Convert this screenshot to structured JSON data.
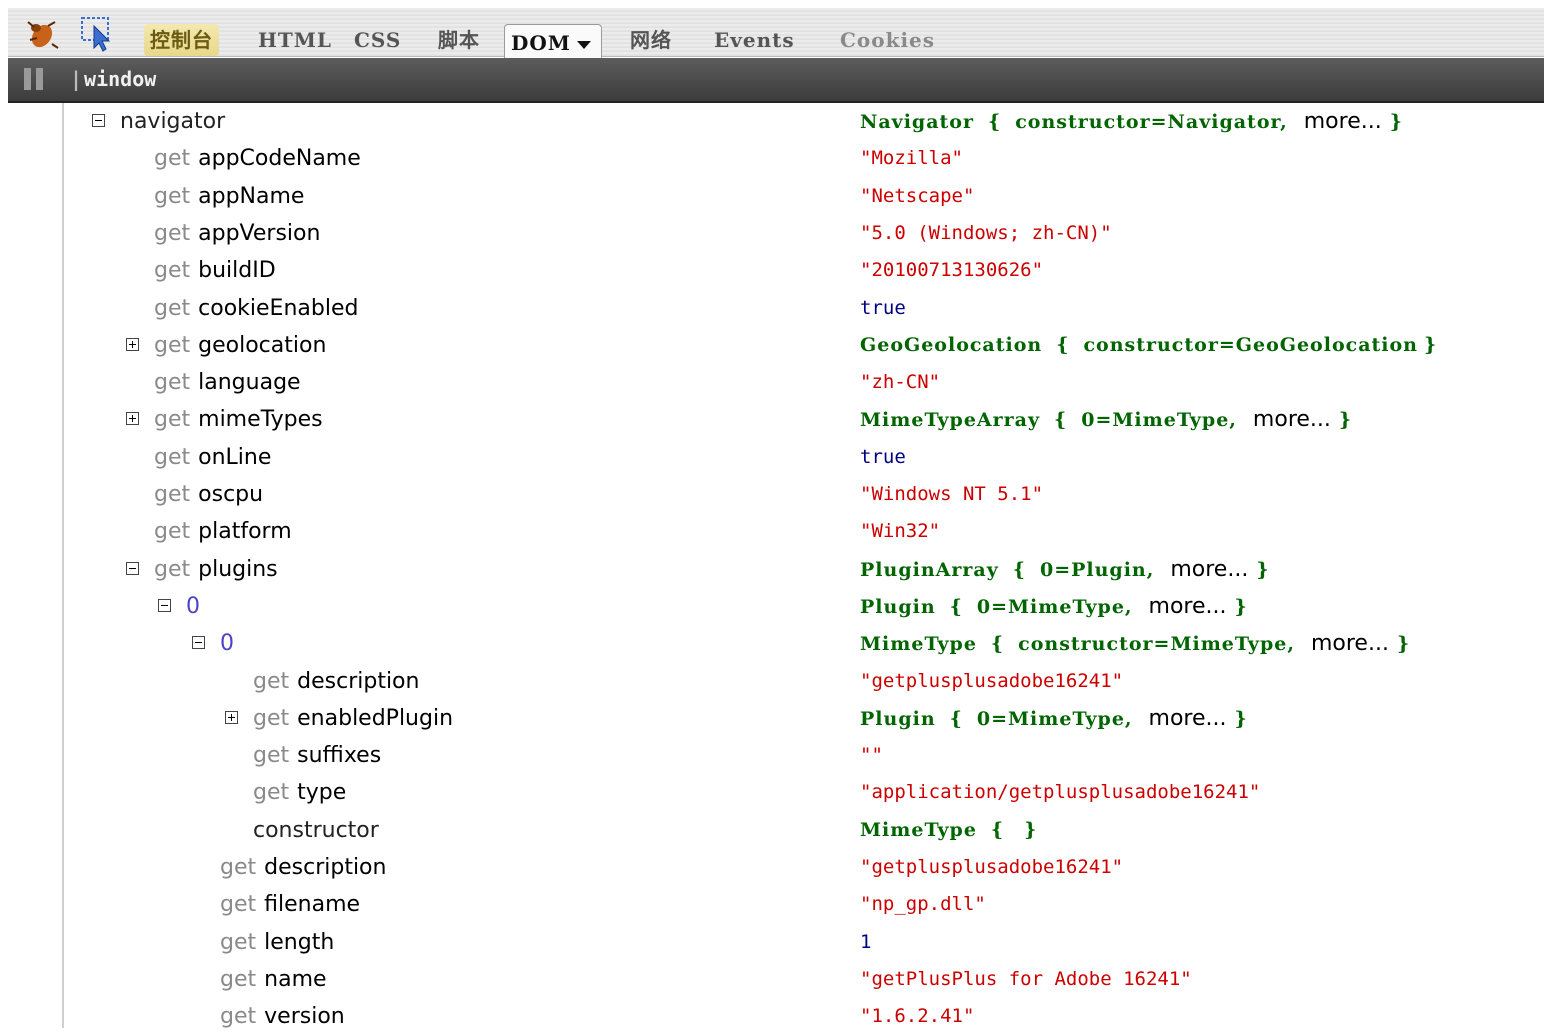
{
  "toolbar": {
    "tabs": [
      {
        "label": "控制台"
      },
      {
        "label": "HTML"
      },
      {
        "label": "CSS"
      },
      {
        "label": "脚本"
      },
      {
        "label": "DOM"
      },
      {
        "label": "网络"
      },
      {
        "label": "Events"
      },
      {
        "label": "Cookies"
      }
    ],
    "active_tab": "DOM"
  },
  "breadcrumb": {
    "separator": "|",
    "label": "window"
  },
  "tree": [
    {
      "prefix": "",
      "name": "navigator",
      "toggle": "minus",
      "value_type": "obj",
      "value": "Navigator",
      "value_inner": "constructor=Navigator,",
      "more": "more...",
      "name_style": "plain"
    },
    {
      "prefix": "get",
      "name": "appCodeName",
      "toggle": "",
      "value_type": "str",
      "value": "\"Mozilla\""
    },
    {
      "prefix": "get",
      "name": "appName",
      "toggle": "",
      "value_type": "str",
      "value": "\"Netscape\""
    },
    {
      "prefix": "get",
      "name": "appVersion",
      "toggle": "",
      "value_type": "str",
      "value": "\"5.0 (Windows; zh-CN)\""
    },
    {
      "prefix": "get",
      "name": "buildID",
      "toggle": "",
      "value_type": "str",
      "value": "\"20100713130626\""
    },
    {
      "prefix": "get",
      "name": "cookieEnabled",
      "toggle": "",
      "value_type": "bool",
      "value": "true"
    },
    {
      "prefix": "get",
      "name": "geolocation",
      "toggle": "plus",
      "value_type": "obj",
      "value": "GeoGeolocation",
      "value_inner": "constructor=GeoGeolocation",
      "more": ""
    },
    {
      "prefix": "get",
      "name": "language",
      "toggle": "",
      "value_type": "str",
      "value": "\"zh-CN\""
    },
    {
      "prefix": "get",
      "name": "mimeTypes",
      "toggle": "plus",
      "value_type": "obj",
      "value": "MimeTypeArray",
      "value_inner": "0=MimeType,",
      "more": "more..."
    },
    {
      "prefix": "get",
      "name": "onLine",
      "toggle": "",
      "value_type": "bool",
      "value": "true"
    },
    {
      "prefix": "get",
      "name": "oscpu",
      "toggle": "",
      "value_type": "str",
      "value": "\"Windows NT 5.1\""
    },
    {
      "prefix": "get",
      "name": "platform",
      "toggle": "",
      "value_type": "str",
      "value": "\"Win32\""
    },
    {
      "prefix": "get",
      "name": "plugins",
      "toggle": "minus",
      "value_type": "obj",
      "value": "PluginArray",
      "value_inner": "0=Plugin,",
      "more": "more..."
    },
    {
      "prefix": "",
      "name": "0",
      "toggle": "minus",
      "value_type": "obj",
      "value": "Plugin",
      "value_inner": "0=MimeType,",
      "more": "more...",
      "name_style": "idx"
    },
    {
      "prefix": "",
      "name": "0",
      "toggle": "minus",
      "value_type": "obj",
      "value": "MimeType",
      "value_inner": "constructor=MimeType,",
      "more": "more...",
      "name_style": "idx"
    },
    {
      "prefix": "get",
      "name": "description",
      "toggle": "",
      "value_type": "str",
      "value": "\"getplusplusadobe16241\""
    },
    {
      "prefix": "get",
      "name": "enabledPlugin",
      "toggle": "plus",
      "value_type": "obj",
      "value": "Plugin",
      "value_inner": "0=MimeType,",
      "more": "more..."
    },
    {
      "prefix": "get",
      "name": "suffixes",
      "toggle": "",
      "value_type": "str",
      "value": "\"\""
    },
    {
      "prefix": "get",
      "name": "type",
      "toggle": "",
      "value_type": "str",
      "value": "\"application/getplusplusadobe16241\""
    },
    {
      "prefix": "",
      "name": "constructor",
      "toggle": "",
      "value_type": "obj",
      "value": "MimeType",
      "value_inner": "",
      "more": "",
      "name_style": "plain"
    },
    {
      "prefix": "get",
      "name": "description",
      "toggle": "",
      "value_type": "str",
      "value": "\"getplusplusadobe16241\""
    },
    {
      "prefix": "get",
      "name": "filename",
      "toggle": "",
      "value_type": "str",
      "value": "\"np_gp.dll\""
    },
    {
      "prefix": "get",
      "name": "length",
      "toggle": "",
      "value_type": "num",
      "value": "1"
    },
    {
      "prefix": "get",
      "name": "name",
      "toggle": "",
      "value_type": "str",
      "value": "\"getPlusPlus for Adobe 16241\""
    },
    {
      "prefix": "get",
      "name": "version",
      "toggle": "",
      "value_type": "str",
      "value": "\"1.6.2.41\""
    }
  ]
}
